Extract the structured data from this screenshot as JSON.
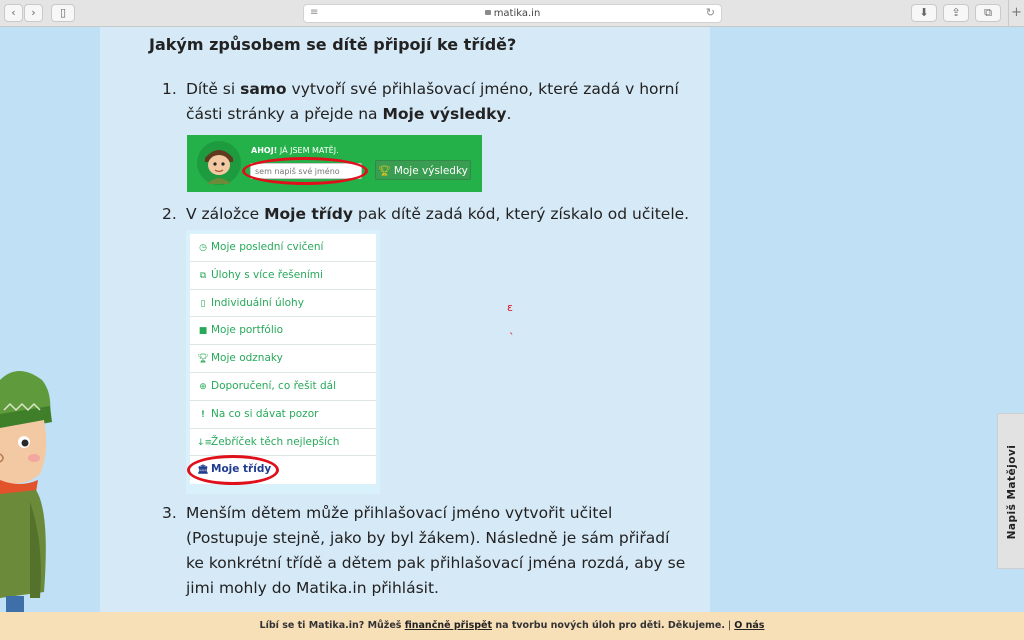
{
  "browser": {
    "url": "matika.in"
  },
  "content": {
    "heading": "Jakým způsobem se dítě připojí ke třídě?",
    "step1": {
      "number": "1.",
      "line1_a": "Dítě si ",
      "line1_b": "samo",
      "line1_c": " vytvoří své přihlašovací jméno, které zadá v horní",
      "line2_a": "části stránky a přejde na ",
      "line2_b": "Moje výsledky",
      "line2_c": "."
    },
    "login_widget": {
      "hello_bold": "AHOJ!",
      "hello_rest": " JÁ JSEM MATĚJ.",
      "name_placeholder": "sem napiš své jméno",
      "results_button": "Moje výsledky"
    },
    "step2": {
      "number": "2.",
      "text_a": "V záložce ",
      "text_b": "Moje třídy",
      "text_c": " pak dítě zadá kód, který získalo od učitele."
    },
    "menu": {
      "items": [
        {
          "label": "Moje poslední cvičení",
          "icon": "clock-icon"
        },
        {
          "label": "Úlohy s více řešeními",
          "icon": "copy-icon"
        },
        {
          "label": "Individuální úlohy",
          "icon": "file-icon"
        },
        {
          "label": "Moje portfólio",
          "icon": "book-icon"
        },
        {
          "label": "Moje odznaky",
          "icon": "trophy-icon"
        },
        {
          "label": "Doporučení, co řešit dál",
          "icon": "lifebuoy-icon"
        },
        {
          "label": "Na co si dávat pozor",
          "icon": "exclamation-icon"
        },
        {
          "label": "Žebříček těch nejlepších",
          "icon": "sort-icon"
        },
        {
          "label": "Moje třídy",
          "icon": "bank-icon"
        }
      ]
    },
    "step3": {
      "number": "3.",
      "lines": [
        "Menším dětem může přihlašovací jméno vytvořit učitel",
        "(Postupuje stejně, jako by byl žákem). Následně je sám přiřadí",
        "ke konkrétní třídě a dětem pak přihlašovací jména rozdá, aby se",
        "jimi mohly do Matika.in přihlásit."
      ]
    }
  },
  "side_tab": {
    "label": "Napiš Matějovi"
  },
  "bottom_bar": {
    "text_a": "Líbí se ti Matika.in? Můžeš ",
    "link_donate": "finančně přispět",
    "text_b": " na tvorbu nových úloh pro děti. Děkujeme.",
    "separator": "|",
    "link_about": "O nás"
  },
  "colors": {
    "page_background": "#bfe0f5",
    "content_background": "#d6e9f6",
    "login_green": "#24b14a",
    "menu_green": "#27a95a",
    "active_blue": "#1f3c8f",
    "highlight_red": "#e0101b",
    "bottom_bar": "#f7dfb8"
  }
}
